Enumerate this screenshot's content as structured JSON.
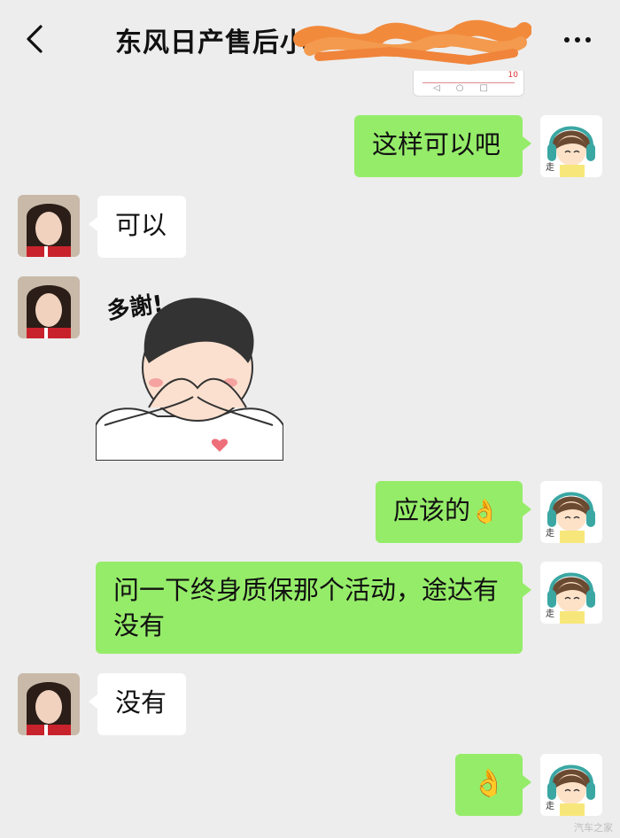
{
  "header": {
    "title": "东风日产售后小"
  },
  "mini_screenshot": {
    "number": "10"
  },
  "messages": [
    {
      "side": "me",
      "text": "这样可以吧"
    },
    {
      "side": "other",
      "text": "可以"
    },
    {
      "side": "other",
      "sticker": "man-covering-face-thanks-sticker",
      "sticker_text": "多謝!"
    },
    {
      "side": "me",
      "text": "应该的",
      "emoji": "👌"
    },
    {
      "side": "me",
      "text": "问一下终身质保那个活动，途达有没有"
    },
    {
      "side": "other",
      "text": "没有"
    },
    {
      "side": "me",
      "emoji": "👌"
    }
  ],
  "watermark": "汽车之家",
  "colors": {
    "me_bubble": "#95ec69",
    "other_bubble": "#ffffff",
    "background": "#ededed",
    "scribble": "#f28a3c"
  }
}
